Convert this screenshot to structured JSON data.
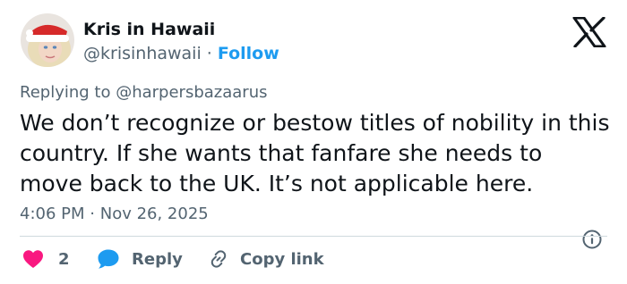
{
  "author": {
    "display_name": "Kris in Hawaii",
    "handle": "@krisinhawaii",
    "separator": "·",
    "follow_label": "Follow",
    "avatar_icon": "user-avatar-santa-hat"
  },
  "brand": {
    "logo_icon": "x-logo"
  },
  "reply_context": {
    "prefix": "Replying to",
    "mention": "@harpersbazaarus"
  },
  "tweet": {
    "text": "We don’t recognize or bestow titles of nobility in this country. If she wants that fanfare she needs to move back to the UK. It’s not applicable here.",
    "time": "4:06 PM",
    "separator": "·",
    "date": "Nov 26, 2025"
  },
  "actions": {
    "like_count": "2",
    "reply_label": "Reply",
    "copy_label": "Copy link"
  },
  "colors": {
    "accent": "#1d9bf0",
    "like": "#f91880",
    "text": "#0f1419",
    "muted": "#536471",
    "divider": "#cfd9de"
  }
}
